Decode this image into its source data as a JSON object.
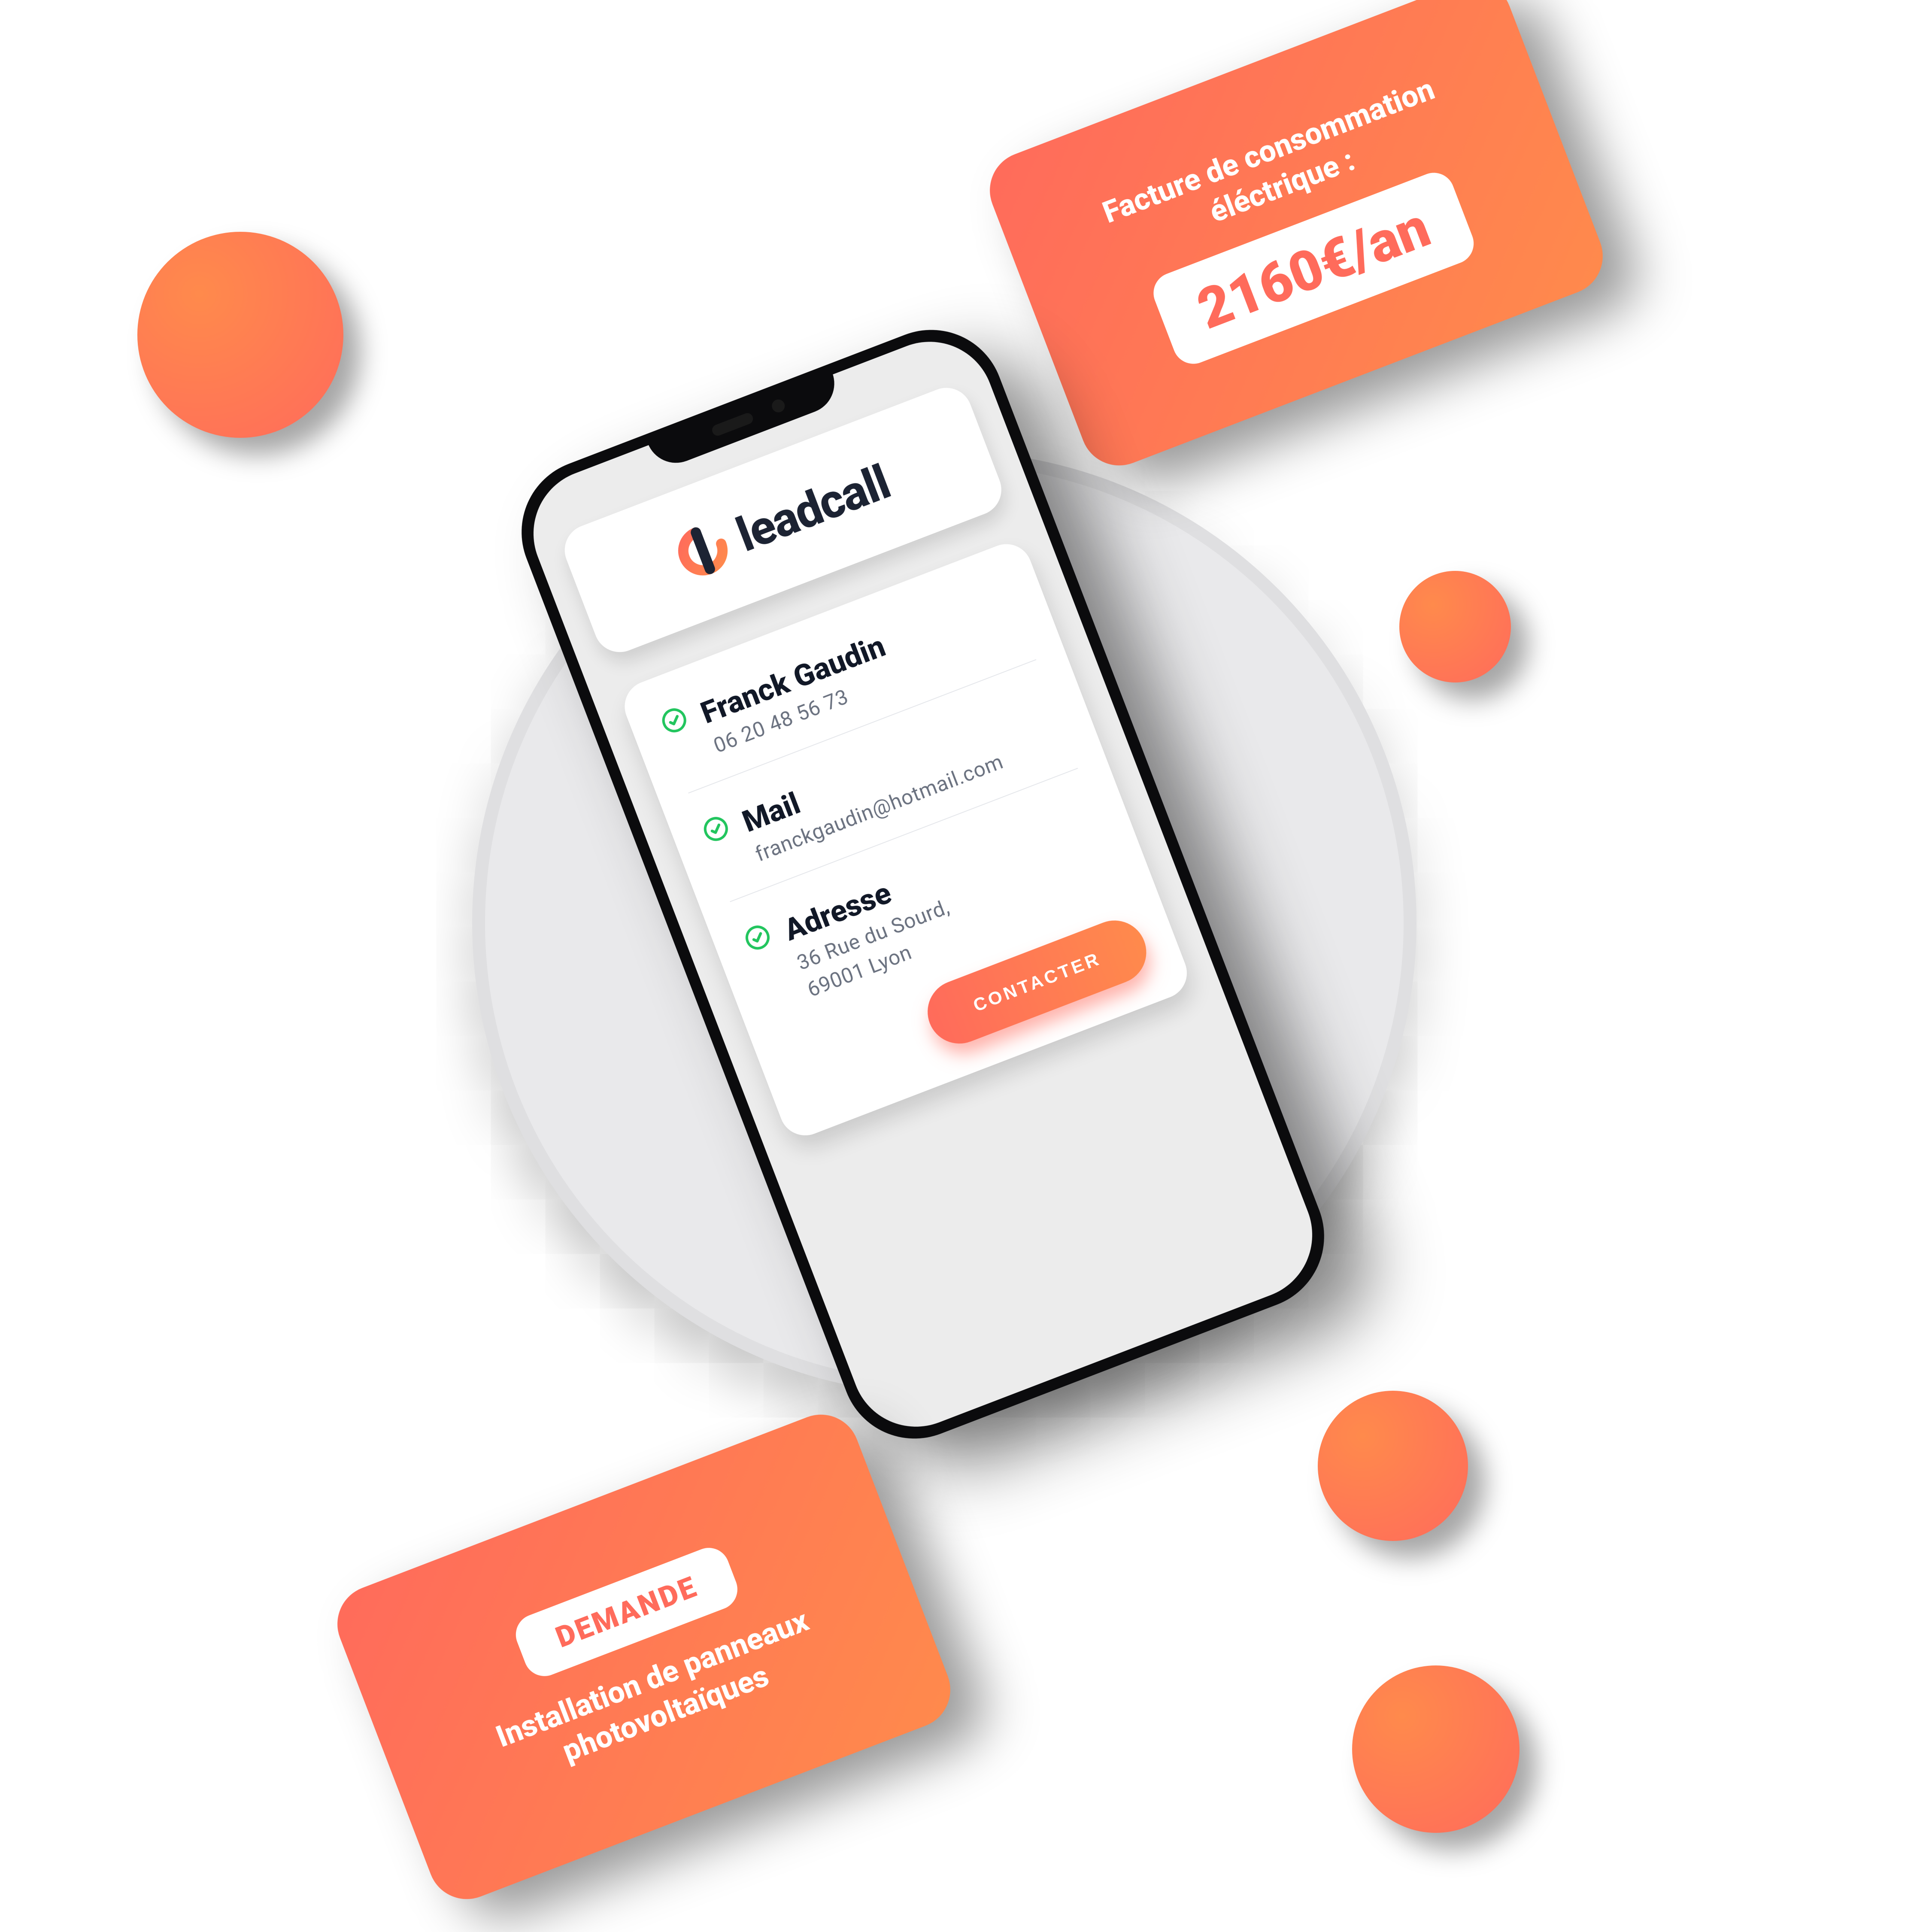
{
  "brand": {
    "name": "leadcall"
  },
  "contact": {
    "name_label": "Franck Gaudin",
    "phone": "06 20 48 56 73",
    "mail_label": "Mail",
    "mail_value": "franckgaudin@hotmail.com",
    "address_label": "Adresse",
    "address_line1": "36 Rue du Sourd,",
    "address_line2": "69001 Lyon"
  },
  "actions": {
    "contact_button": "CONTACTER"
  },
  "cards": {
    "bill": {
      "heading": "Facture de consommation éléctrique :",
      "amount": "2160€/an"
    },
    "request": {
      "badge": "DEMANDE",
      "text": "Installation de panneaux photovoltaïques"
    }
  }
}
